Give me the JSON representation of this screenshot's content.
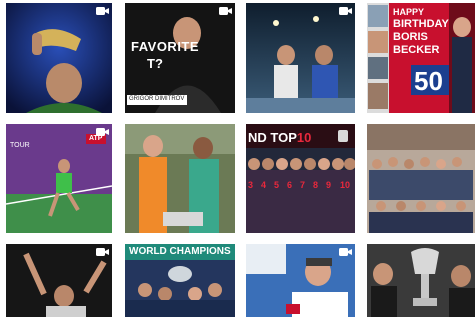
{
  "tiles": {
    "t2": {
      "headline_1": "FAVORITE",
      "headline_2": "T?",
      "caption": "GRIGOR DIMITROV"
    },
    "t4": {
      "line1": "HAPPY",
      "line2": "BIRTHDAY",
      "line3": "BORIS",
      "line4": "BECKER",
      "age": "50"
    },
    "t5": {
      "corner": "TOUR",
      "badge": "ATP"
    },
    "t7": {
      "title_prefix": "ND TOP",
      "title_number": "10",
      "numbers": [
        "3",
        "4",
        "5",
        "6",
        "7",
        "8",
        "9",
        "10"
      ]
    },
    "t10": {
      "banner": "WORLD CHAMPIONS"
    }
  },
  "icons": {
    "tile_icon": "video-camera-icon",
    "accent": "#c8102e"
  }
}
